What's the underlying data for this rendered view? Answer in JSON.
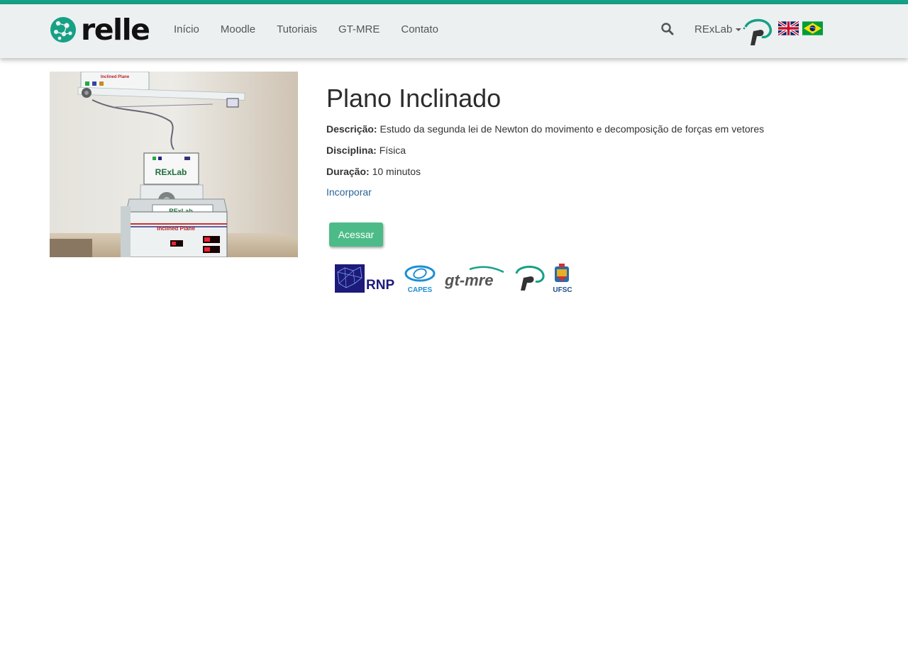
{
  "nav": {
    "brand": "relle",
    "links": [
      "Início",
      "Moodle",
      "Tutoriais",
      "GT-MRE",
      "Contato"
    ],
    "user_menu": "RExLab",
    "icons": {
      "search": "search-icon",
      "rexlab_logo": "rexlab-logo-icon",
      "flag_en": "uk-flag-icon",
      "flag_pt": "brazil-flag-icon"
    }
  },
  "photo": {
    "labels": [
      "Inclined Plane",
      "RExLab",
      "RExLab",
      "Inclined Plane"
    ]
  },
  "experiment": {
    "title": "Plano Inclinado",
    "description_label": "Descrição:",
    "description": "Estudo da segunda lei de Newton do movimento e decomposição de forças em vetores",
    "discipline_label": "Disciplina:",
    "discipline": "Física",
    "duration_label": "Duração:",
    "duration": "10 minutos",
    "embed_link": "Incorporar",
    "access_button": "Acessar"
  },
  "sponsors": {
    "rnp": "RNP",
    "capes": "CAPES",
    "gtmre": "gt-mre",
    "ufsc": "UFSC"
  },
  "colors": {
    "accent": "#16a085",
    "navbar_bg": "#ecf0f1",
    "button": "#4dbb88",
    "link": "#2a6496"
  }
}
